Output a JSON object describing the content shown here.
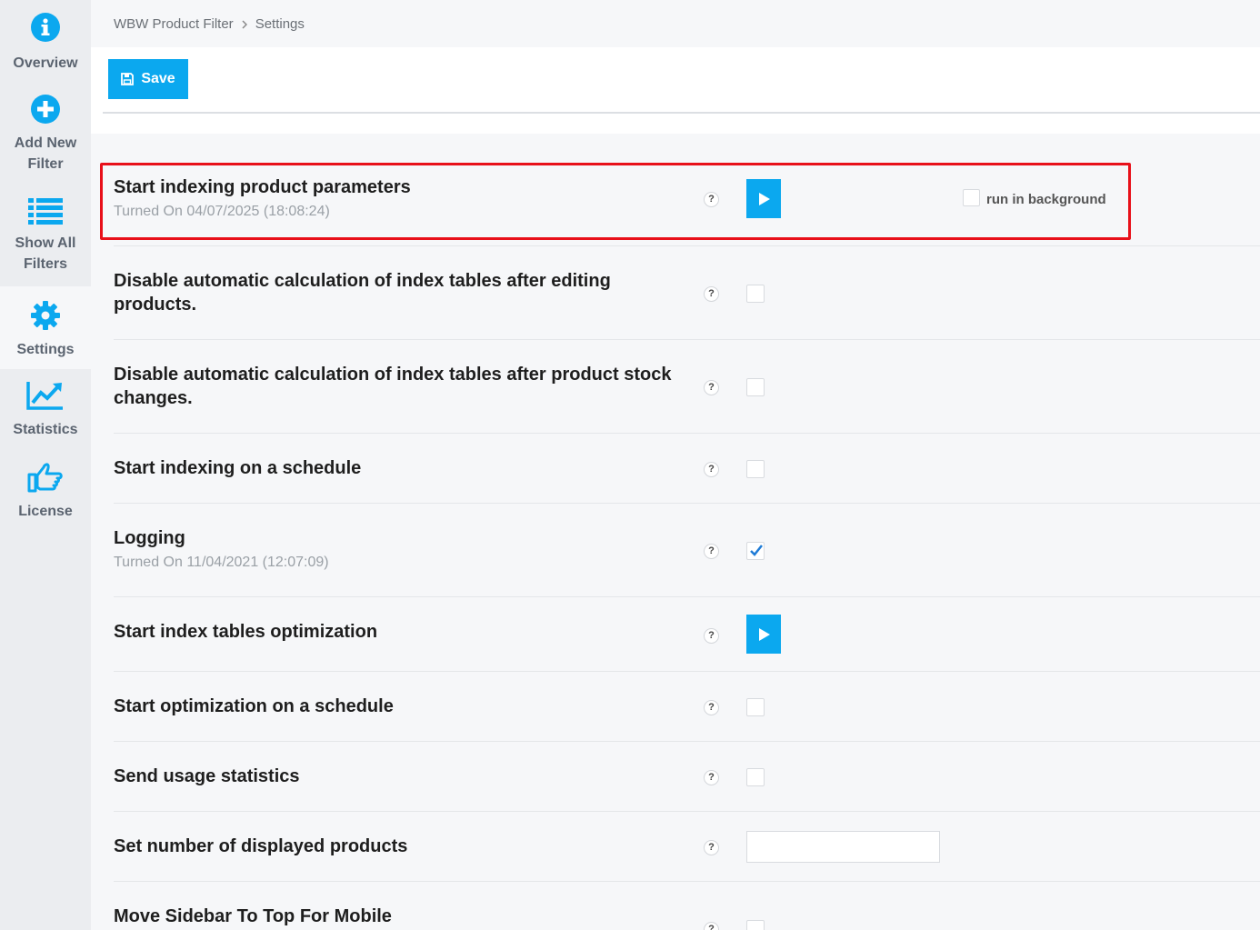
{
  "sidebar": {
    "items": [
      {
        "label": "Overview",
        "icon": "info-icon"
      },
      {
        "label": "Add New Filter",
        "icon": "plus-circle-icon"
      },
      {
        "label": "Show All Filters",
        "icon": "list-icon"
      },
      {
        "label": "Settings",
        "icon": "gear-icon",
        "active": true
      },
      {
        "label": "Statistics",
        "icon": "chart-line-icon"
      },
      {
        "label": "License",
        "icon": "thumbs-up-icon"
      }
    ]
  },
  "breadcrumb": {
    "root": "WBW Product Filter",
    "current": "Settings"
  },
  "toolbar": {
    "save_label": "Save"
  },
  "settings": [
    {
      "title": "Start indexing product parameters",
      "subtitle": "Turned On 04/07/2025 (18:08:24)",
      "control": "play-button",
      "extra_checkbox_label": "run in background",
      "extra_checked": false,
      "highlighted": true
    },
    {
      "title": "Disable automatic calculation of index tables after editing products.",
      "control": "checkbox",
      "checked": false
    },
    {
      "title": "Disable automatic calculation of index tables after product stock changes.",
      "control": "checkbox",
      "checked": false
    },
    {
      "title": "Start indexing on a schedule",
      "control": "checkbox",
      "checked": false
    },
    {
      "title": "Logging",
      "subtitle": "Turned On 11/04/2021 (12:07:09)",
      "control": "checkbox",
      "checked": true
    },
    {
      "title": "Start index tables optimization",
      "control": "play-button"
    },
    {
      "title": "Start optimization on a schedule",
      "control": "checkbox",
      "checked": false
    },
    {
      "title": "Send usage statistics",
      "control": "checkbox",
      "checked": false
    },
    {
      "title": "Set number of displayed products",
      "control": "text-input",
      "value": ""
    },
    {
      "title": "Move Sidebar To Top For Mobile",
      "control": "checkbox",
      "checked": false
    }
  ],
  "help_glyph": "?",
  "colors": {
    "accent": "#0ba8ef",
    "highlight": "#e8101a",
    "sidebar_bg": "#ebedf0",
    "nav_text": "#5b6470"
  }
}
